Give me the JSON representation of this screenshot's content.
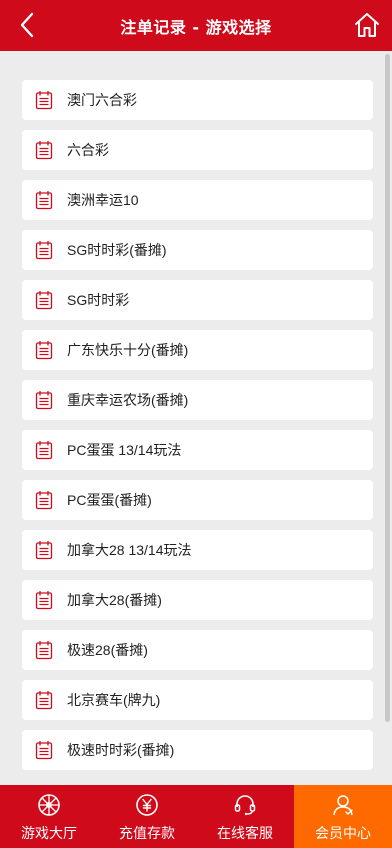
{
  "header": {
    "title": "注单记录 - 游戏选择",
    "back_icon": "chevron-left-icon",
    "home_icon": "home-icon"
  },
  "games": [
    {
      "label": "澳门六合彩",
      "icon": "document-list-icon"
    },
    {
      "label": "六合彩",
      "icon": "document-list-icon"
    },
    {
      "label": "澳洲幸运10",
      "icon": "document-list-icon"
    },
    {
      "label": "SG时时彩(番摊)",
      "icon": "document-list-icon"
    },
    {
      "label": "SG时时彩",
      "icon": "document-list-icon"
    },
    {
      "label": "广东快乐十分(番摊)",
      "icon": "document-list-icon"
    },
    {
      "label": "重庆幸运农场(番摊)",
      "icon": "document-list-icon"
    },
    {
      "label": "PC蛋蛋 13/14玩法",
      "icon": "document-list-icon"
    },
    {
      "label": "PC蛋蛋(番摊)",
      "icon": "document-list-icon"
    },
    {
      "label": "加拿大28 13/14玩法",
      "icon": "document-list-icon"
    },
    {
      "label": "加拿大28(番摊)",
      "icon": "document-list-icon"
    },
    {
      "label": "极速28(番摊)",
      "icon": "document-list-icon"
    },
    {
      "label": "北京赛车(牌九)",
      "icon": "document-list-icon"
    },
    {
      "label": "极速时时彩(番摊)",
      "icon": "document-list-icon"
    }
  ],
  "tabbar": {
    "tabs": [
      {
        "label": "游戏大厅",
        "icon": "wheel-icon",
        "active": false
      },
      {
        "label": "充值存款",
        "icon": "yen-coin-icon",
        "active": false
      },
      {
        "label": "在线客服",
        "icon": "headset-icon",
        "active": false
      },
      {
        "label": "会员中心",
        "icon": "user-icon",
        "active": true
      }
    ]
  },
  "colors": {
    "primary": "#cf0a1b",
    "active_tab": "#ff6a00",
    "background": "#ececec",
    "card": "#ffffff"
  }
}
